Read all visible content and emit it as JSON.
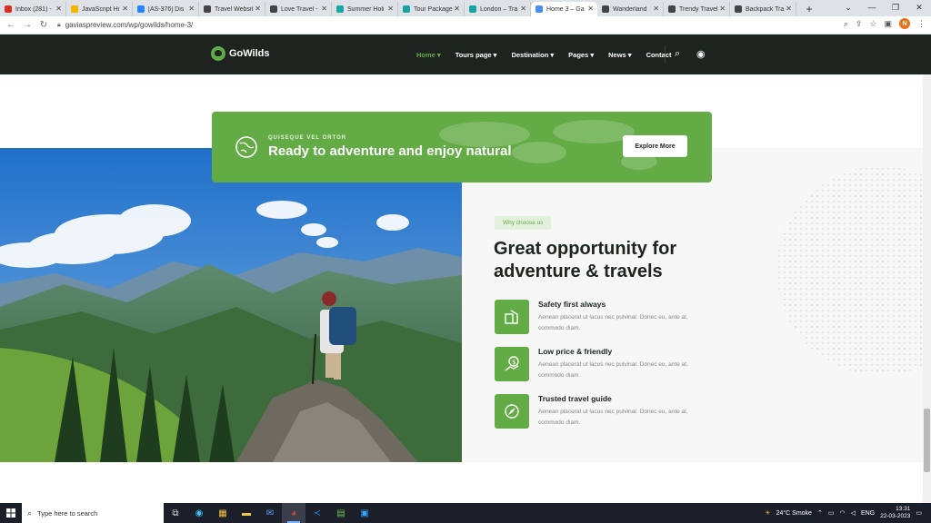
{
  "browser": {
    "tabs": [
      {
        "label": "Inbox (281) -",
        "color": "#d93025"
      },
      {
        "label": "JavaScript Hi",
        "color": "#f4b400"
      },
      {
        "label": "[AS-376] Dis",
        "color": "#2684ff"
      },
      {
        "label": "Travel Websit",
        "color": "#444444"
      },
      {
        "label": "Love Travel -",
        "color": "#444444"
      },
      {
        "label": "Summer Holi",
        "color": "#1aa3a3"
      },
      {
        "label": "Tour Package",
        "color": "#1aa3a3"
      },
      {
        "label": "London – Tra",
        "color": "#1aa3a3"
      },
      {
        "label": "Home 3 – Ga",
        "color": "#4a8df8",
        "active": true
      },
      {
        "label": "Wanderland",
        "color": "#444444"
      },
      {
        "label": "Trendy Travel",
        "color": "#444444"
      },
      {
        "label": "Backpack Tra",
        "color": "#444444"
      }
    ],
    "url": "gaviaspreview.com/wp/gowilds/home-3/",
    "profile_initial": "N"
  },
  "site": {
    "logo": "GoWilds",
    "menu": [
      {
        "label": "Home",
        "active": true
      },
      {
        "label": "Tours page",
        "active": false
      },
      {
        "label": "Destination",
        "active": false
      },
      {
        "label": "Pages",
        "active": false
      },
      {
        "label": "News",
        "active": false
      },
      {
        "label": "Contact",
        "active": false
      }
    ],
    "accent": "#63ab45",
    "header_bg": "#1d231f"
  },
  "banner": {
    "kicker": "QUISEQUE VEL ORTOR",
    "title": "Ready to adventure and enjoy natural",
    "button": "Explore More"
  },
  "why": {
    "badge": "Why choose us",
    "headline": "Great opportunity for adventure & travels",
    "features": [
      {
        "title": "Safety first always",
        "desc": "Aenean placerat ut lacus nec pulvinar. Donec eu, ante at, commodo diam.",
        "icon": "safety-icon"
      },
      {
        "title": "Low price & friendly",
        "desc": "Aenean placerat ut lacus nec pulvinar. Donec eu, ante at, commodo diam.",
        "icon": "price-icon"
      },
      {
        "title": "Trusted travel guide",
        "desc": "Aenean placerat ut lacus nec pulvinar. Donec eu, ante at, commodo diam.",
        "icon": "guide-icon"
      }
    ]
  },
  "taskbar": {
    "search_placeholder": "Type here to search",
    "weather": "24°C  Smoke",
    "language": "ENG",
    "time": "13:31",
    "date": "22-03-2023"
  }
}
